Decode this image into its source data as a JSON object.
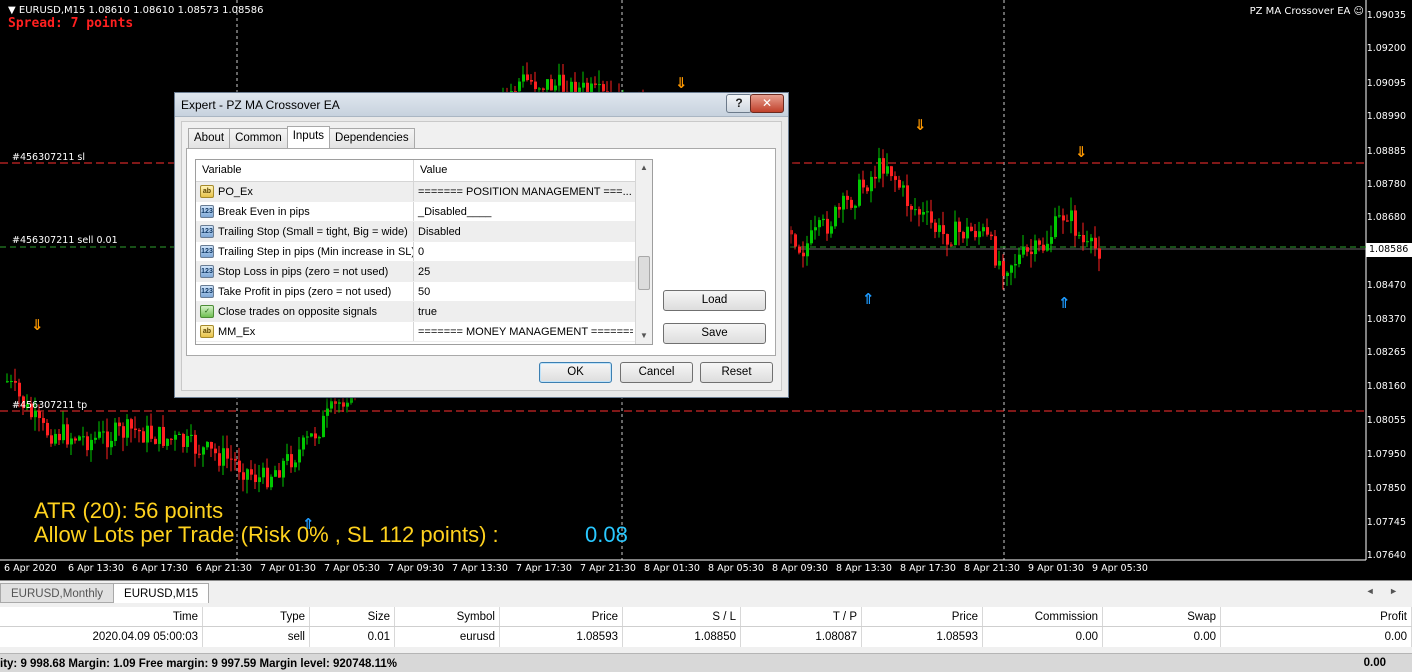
{
  "chart": {
    "symbol_header": "EURUSD,M15  1.08610 1.08610 1.08573 1.08586",
    "spread": "Spread: 7 points",
    "ea_name": "PZ MA Crossover EA ☺",
    "current_price": "1.08586",
    "price_axis": [
      "1.09035",
      "1.09200",
      "1.09095",
      "1.08990",
      "1.08885",
      "1.08780",
      "1.08680",
      "1.08575",
      "1.08470",
      "1.08370",
      "1.08265",
      "1.08160",
      "1.08055",
      "1.07950",
      "1.07850",
      "1.07745",
      "1.07640"
    ],
    "time_axis": [
      "6 Apr 2020",
      "6 Apr 13:30",
      "6 Apr 17:30",
      "6 Apr 21:30",
      "7 Apr 01:30",
      "7 Apr 05:30",
      "7 Apr 09:30",
      "7 Apr 13:30",
      "7 Apr 17:30",
      "7 Apr 21:30",
      "8 Apr 01:30",
      "8 Apr 05:30",
      "8 Apr 09:30",
      "8 Apr 13:30",
      "8 Apr 17:30",
      "8 Apr 21:30",
      "9 Apr 01:30",
      "9 Apr 05:30"
    ],
    "line_labels": {
      "sl": "#456307211 sl",
      "sell": "#456307211 sell 0.01",
      "tp": "#456307211 tp"
    },
    "atr_text": "ATR (20): 56 points",
    "lots_text": "Allow Lots per Trade (Risk 0% , SL 112 points) :",
    "lots_value": "0.08",
    "colors": {
      "bull": "#00c800",
      "bear": "#ff2020",
      "sl_line": "#ff3030",
      "sell_line": "#2ea02e",
      "down_arrow": "#ff9900",
      "up_arrow": "#1e9bff",
      "text_yellow": "#ffd21e"
    }
  },
  "dialog": {
    "title": "Expert - PZ MA Crossover EA",
    "help_label": "?",
    "close_label": "✕",
    "tabs": [
      "About",
      "Common",
      "Inputs",
      "Dependencies"
    ],
    "active_tab": "Inputs",
    "grid_headers": {
      "variable": "Variable",
      "value": "Value"
    },
    "rows": [
      {
        "icon": "ab",
        "type": "str",
        "variable": "PO_Ex",
        "value": "======= POSITION MANAGEMENT ===..."
      },
      {
        "icon": "123",
        "type": "num",
        "variable": "Break Even in pips",
        "value": "_Disabled____"
      },
      {
        "icon": "123",
        "type": "num",
        "variable": "Trailing Stop (Small = tight, Big = wide)",
        "value": "Disabled"
      },
      {
        "icon": "123",
        "type": "num",
        "variable": "Trailing Step in pips (Min increase in SL)",
        "value": "0"
      },
      {
        "icon": "123",
        "type": "num",
        "variable": "Stop Loss in pips (zero = not used)",
        "value": "25"
      },
      {
        "icon": "123",
        "type": "num",
        "variable": "Take Profit in pips (zero = not used)",
        "value": "50"
      },
      {
        "icon": "✓",
        "type": "bool",
        "variable": "Close trades on opposite signals",
        "value": "true"
      },
      {
        "icon": "ab",
        "type": "str",
        "variable": "MM_Ex",
        "value": "======= MONEY MANAGEMENT ======="
      }
    ],
    "load_label": "Load",
    "save_label": "Save",
    "ok_label": "OK",
    "cancel_label": "Cancel",
    "reset_label": "Reset"
  },
  "bottom": {
    "symbol_tabs": [
      "EURUSD,Monthly",
      "EURUSD,M15"
    ],
    "active_symbol_tab": "EURUSD,M15",
    "nav_arrows": "◄ ►",
    "trade_headers": [
      "Time",
      "Type",
      "Size",
      "Symbol",
      "Price",
      "S / L",
      "T / P",
      "Price",
      "Commission",
      "Swap",
      "Profit"
    ],
    "trade_row": [
      "2020.04.09 05:00:03",
      "sell",
      "0.01",
      "eurusd",
      "1.08593",
      "1.08850",
      "1.08087",
      "1.08593",
      "0.00",
      "0.00",
      "0.00"
    ],
    "status_text": "ity: 9 998.68  Margin: 1.09  Free margin: 9 997.59  Margin level: 920748.11%",
    "status_profit": "0.00"
  }
}
